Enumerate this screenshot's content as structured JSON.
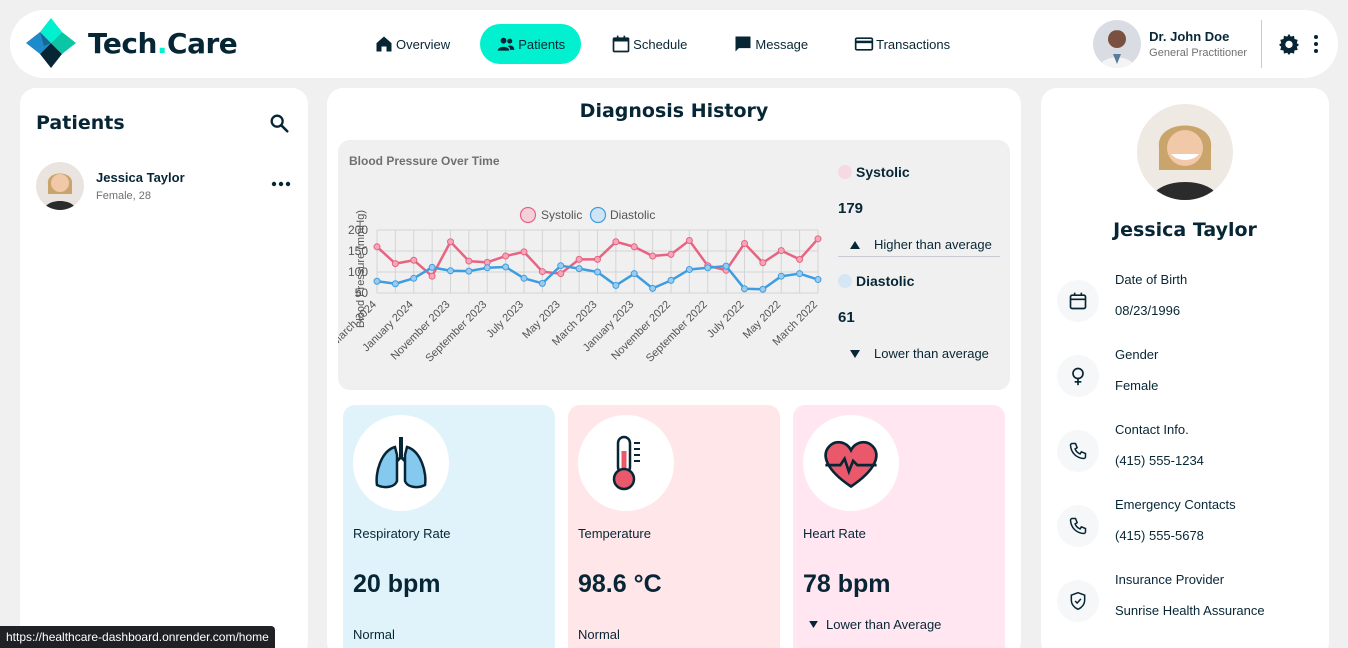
{
  "brand": {
    "name_part1": "Tech",
    "name_dot": ".",
    "name_part2": "Care"
  },
  "nav": {
    "items": [
      {
        "label": "Overview",
        "icon": "home-icon",
        "active": false
      },
      {
        "label": "Patients",
        "icon": "users-icon",
        "active": true
      },
      {
        "label": "Schedule",
        "icon": "calendar-icon",
        "active": false
      },
      {
        "label": "Message",
        "icon": "chat-icon",
        "active": false
      },
      {
        "label": "Transactions",
        "icon": "credit-card-icon",
        "active": false
      }
    ]
  },
  "user": {
    "name": "Dr. John Doe",
    "role": "General Practitioner"
  },
  "patients": {
    "title": "Patients",
    "list": [
      {
        "name": "Jessica Taylor",
        "sub": "Female, 28"
      }
    ]
  },
  "diagnosis": {
    "title": "Diagnosis History",
    "systolic": {
      "label": "Systolic",
      "value": "179",
      "trend": "Higher than average",
      "color": "#e66fd2"
    },
    "diastolic": {
      "label": "Diastolic",
      "value": "61",
      "trend": "Lower than average",
      "color": "#8c6fe6"
    }
  },
  "chart_data": {
    "type": "line",
    "title": "Blood Pressure Over Time",
    "ylabel": "Blood Pressure (mmHg)",
    "xlabel": "",
    "ylim": [
      50,
      200
    ],
    "yticks": [
      50,
      100,
      150,
      200
    ],
    "grid": true,
    "legend_position": "top",
    "x": [
      "March 2024",
      "February 2024",
      "January 2024",
      "December 2023",
      "November 2023",
      "October 2023",
      "September 2023",
      "August 2023",
      "July 2023",
      "June 2023",
      "May 2023",
      "April 2023",
      "March 2023",
      "February 2023",
      "January 2023",
      "December 2022",
      "November 2022",
      "October 2022",
      "September 2022",
      "August 2022",
      "July 2022",
      "June 2022",
      "May 2022",
      "April 2022",
      "March 2022"
    ],
    "xticks_shown": [
      "March 2024",
      "January 2024",
      "November 2023",
      "September 2023",
      "July 2023",
      "May 2023",
      "March 2023",
      "January 2023",
      "November 2022",
      "September 2022",
      "July 2022",
      "May 2022",
      "March 2022"
    ],
    "series": [
      {
        "name": "Systolic",
        "color": "#e66fd2",
        "values": [
          160,
          120,
          128,
          90,
          172,
          126,
          123,
          138,
          148,
          101,
          96,
          130,
          130,
          172,
          160,
          138,
          142,
          175,
          115,
          104,
          168,
          122,
          151,
          130,
          179
        ]
      },
      {
        "name": "Diastolic",
        "color": "#8c6fe6",
        "values": [
          78,
          72,
          85,
          111,
          103,
          102,
          110,
          112,
          85,
          73,
          115,
          108,
          100,
          68,
          96,
          61,
          80,
          106,
          110,
          114,
          60,
          59,
          90,
          96,
          82
        ]
      }
    ]
  },
  "vitals": [
    {
      "label": "Respiratory Rate",
      "value": "20 bpm",
      "status": "Normal",
      "icon": "lungs-icon",
      "bg": "#E0F3FA"
    },
    {
      "label": "Temperature",
      "value": "98.6 °C",
      "status": "Normal",
      "icon": "thermometer-icon",
      "bg": "#FFE6E9"
    },
    {
      "label": "Heart Rate",
      "value": "78 bpm",
      "status": "Lower than Average",
      "icon": "heart-icon",
      "bg": "#FFE6F1"
    }
  ],
  "profile": {
    "name": "Jessica Taylor",
    "fields": [
      {
        "label": "Date of Birth",
        "value": "08/23/1996",
        "icon": "calendar-icon"
      },
      {
        "label": "Gender",
        "value": "Female",
        "icon": "female-icon"
      },
      {
        "label": "Contact Info.",
        "value": "(415) 555-1234",
        "icon": "phone-icon"
      },
      {
        "label": "Emergency Contacts",
        "value": "(415) 555-5678",
        "icon": "phone-icon"
      },
      {
        "label": "Insurance Provider",
        "value": "Sunrise Health Assurance",
        "icon": "shield-icon"
      }
    ]
  },
  "status_bar": {
    "url": "https://healthcare-dashboard.onrender.com/home"
  }
}
